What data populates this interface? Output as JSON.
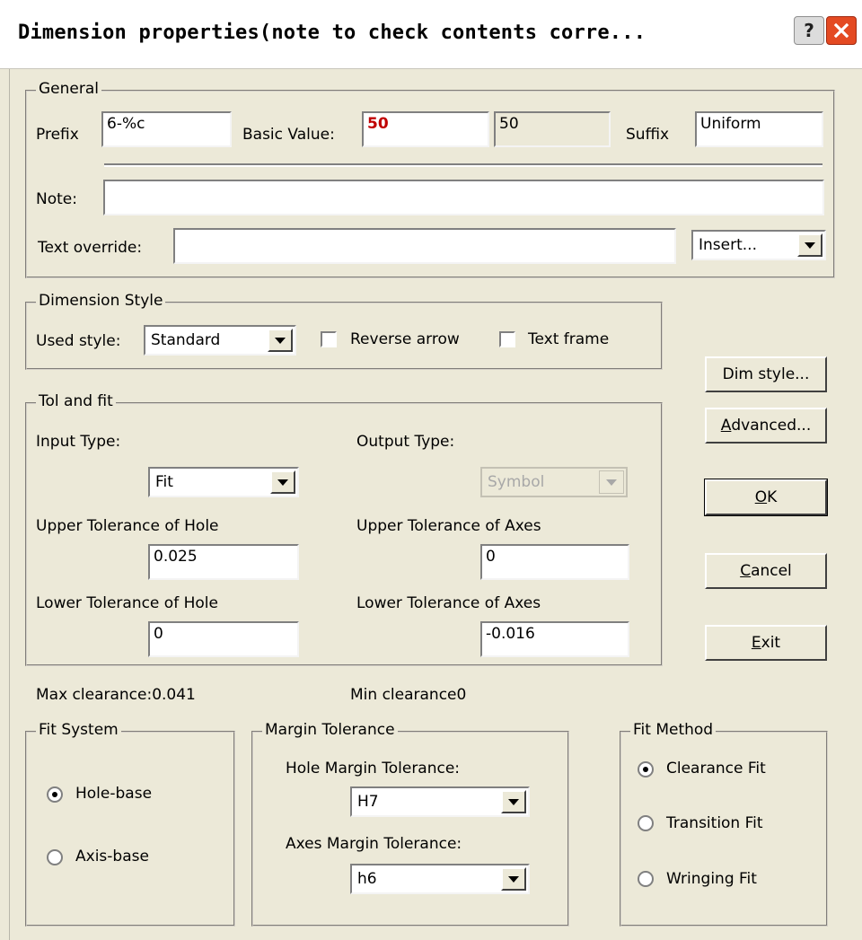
{
  "window": {
    "title": "Dimension properties(note to check contents corre...",
    "help_glyph": "?",
    "close_glyph": "✕"
  },
  "general": {
    "legend": "General",
    "prefix_label": "Prefix",
    "prefix_value": "6-%c",
    "basic_value_label": "Basic Value:",
    "basic_value": "50",
    "basic_value_readonly": "50",
    "suffix_label": "Suffix",
    "suffix_value": "Uniform",
    "note_label": "Note:",
    "note_value": "",
    "text_override_label": "Text override:",
    "text_override_value": "",
    "insert_label": "Insert..."
  },
  "dimension_style": {
    "legend": "Dimension Style",
    "used_style_label": "Used style:",
    "used_style_value": "Standard",
    "reverse_arrow_label": "Reverse arrow",
    "text_frame_label": "Text frame"
  },
  "tol_fit": {
    "legend": "Tol and fit",
    "input_type_label": "Input Type:",
    "input_type_value": "Fit",
    "output_type_label": "Output Type:",
    "output_type_value": "Symbol",
    "upper_hole_label": "Upper Tolerance of Hole",
    "upper_hole_value": "0.025",
    "upper_axes_label": "Upper Tolerance of Axes",
    "upper_axes_value": "0",
    "lower_hole_label": "Lower Tolerance of Hole",
    "lower_hole_value": "0",
    "lower_axes_label": "Lower Tolerance of Axes",
    "lower_axes_value": "-0.016"
  },
  "clearance": {
    "max": "Max clearance:0.041",
    "min": "Min clearance0"
  },
  "fit_system": {
    "legend": "Fit System",
    "options": [
      "Hole-base",
      "Axis-base"
    ]
  },
  "margin_tolerance": {
    "legend": "Margin Tolerance",
    "hole_label": "Hole Margin Tolerance:",
    "hole_value": "H7",
    "axes_label": "Axes Margin Tolerance:",
    "axes_value": "h6"
  },
  "fit_method": {
    "legend": "Fit Method",
    "options": [
      "Clearance Fit",
      "Transition Fit",
      "Wringing Fit"
    ]
  },
  "buttons": {
    "dim_style": "Dim style...",
    "advanced_key": "A",
    "advanced_rest": "dvanced...",
    "ok_key": "O",
    "ok_rest": "K",
    "cancel_key": "C",
    "cancel_rest": "ancel",
    "exit_key": "E",
    "exit_rest": "xit"
  },
  "colors": {
    "basic_value": "#c00000",
    "close_button": "#e44a22",
    "dialog_bg": "#ece9d8"
  }
}
